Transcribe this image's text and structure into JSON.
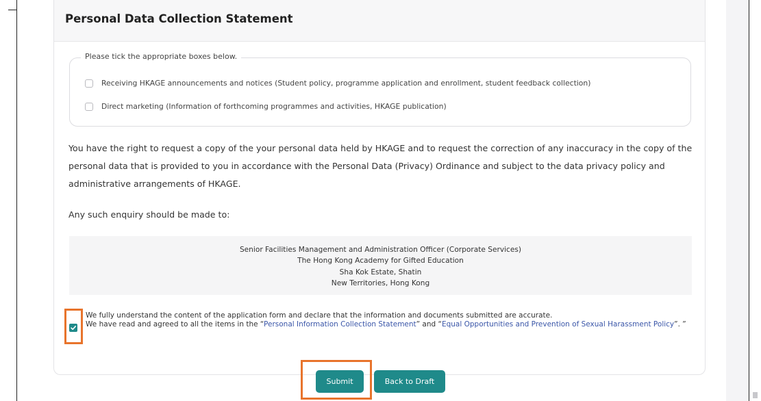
{
  "section": {
    "title": "Personal Data Collection Statement"
  },
  "consent_box": {
    "legend": "Please tick the appropriate boxes below.",
    "options": [
      {
        "label": "Receiving HKAGE announcements and notices (Student policy, programme application and enrollment, student feedback collection)",
        "checked": false
      },
      {
        "label": "Direct marketing (Information of forthcoming programmes and activities, HKAGE publication)",
        "checked": false
      }
    ]
  },
  "rights_paragraph": "You have the right to request a copy of the your personal data held by HKAGE and to request the correction of any inaccuracy in the copy of the personal data that is provided to you in accordance with the Personal Data (Privacy) Ordinance and subject to the data privacy policy and administrative arrangements of HKAGE.",
  "enquiry_label": "Any such enquiry should be made to:",
  "address": {
    "lines": [
      "Senior Facilities Management and Administration Officer (Corporate Services)",
      "The Hong Kong Academy for Gifted Education",
      "Sha Kok Estate, Shatin",
      "New Territories, Hong Kong"
    ]
  },
  "declaration": {
    "checked": true,
    "line1": "We fully understand the content of the application form and declare that the information and documents submitted are accurate.",
    "line2_prefix": "We have read and agreed to all the items in the “",
    "link1": "Personal Information Collection Statement",
    "line2_middle": "” and “",
    "link2": "Equal Opportunities and Prevention of Sexual Harassment Policy",
    "line2_suffix": "”. ”"
  },
  "actions": {
    "submit_label": "Submit",
    "back_label": "Back to Draft"
  },
  "colors": {
    "accent": "#1f8a8a",
    "highlight": "#e8742c",
    "link": "#3a56a8"
  }
}
